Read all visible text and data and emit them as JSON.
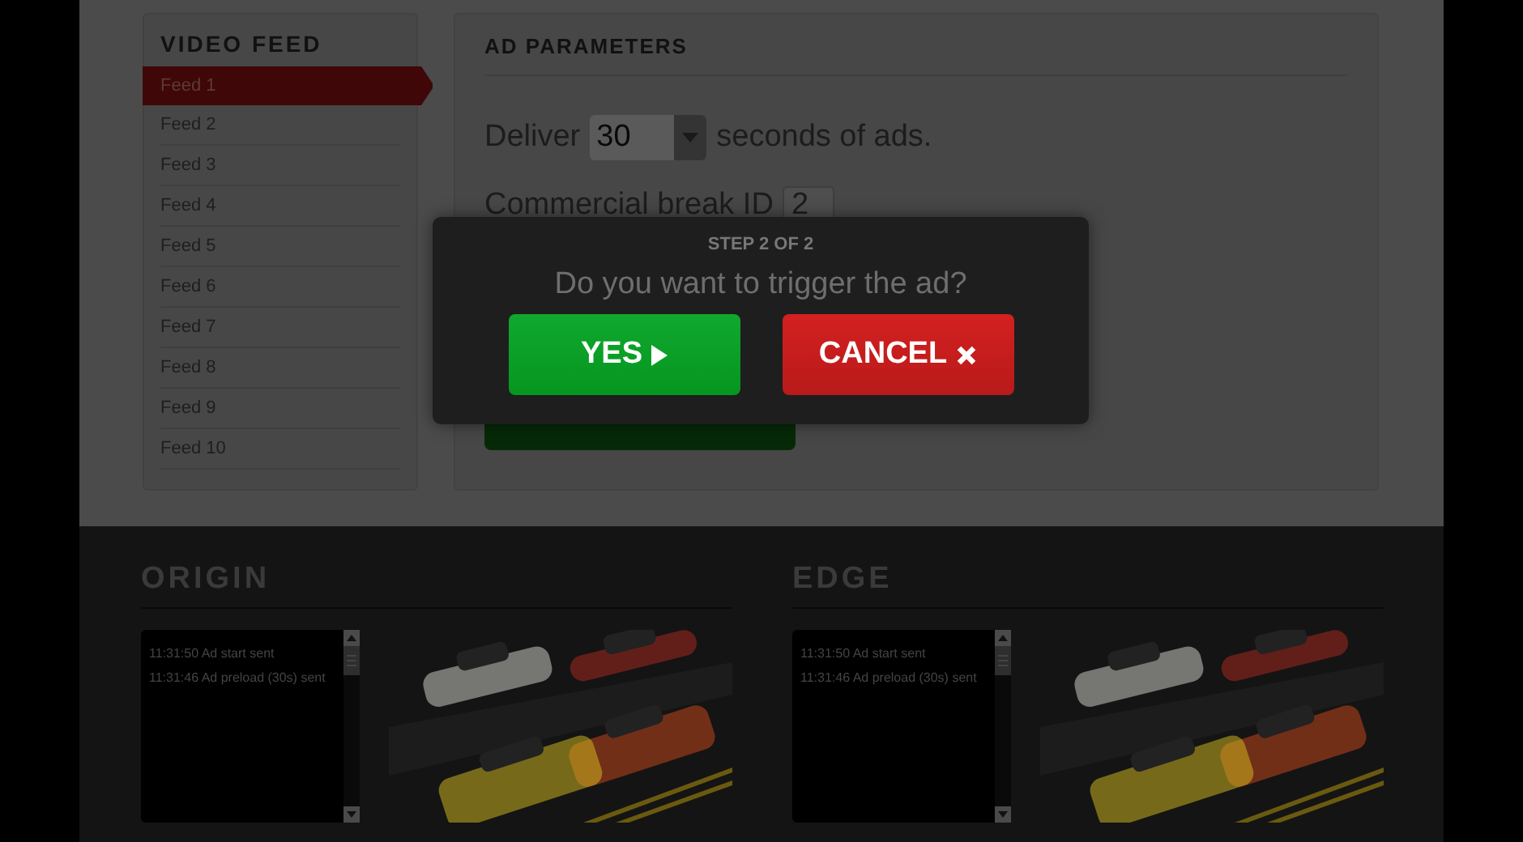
{
  "sidebar": {
    "title": "VIDEO FEED",
    "items": [
      {
        "label": "Feed 1",
        "selected": true
      },
      {
        "label": "Feed 2",
        "selected": false
      },
      {
        "label": "Feed 3",
        "selected": false
      },
      {
        "label": "Feed 4",
        "selected": false
      },
      {
        "label": "Feed 5",
        "selected": false
      },
      {
        "label": "Feed 6",
        "selected": false
      },
      {
        "label": "Feed 7",
        "selected": false
      },
      {
        "label": "Feed 8",
        "selected": false
      },
      {
        "label": "Feed 9",
        "selected": false
      },
      {
        "label": "Feed 10",
        "selected": false
      }
    ]
  },
  "ad_parameters": {
    "title": "AD PARAMETERS",
    "deliver": {
      "before": "Deliver",
      "value": "30",
      "after": "seconds of ads."
    },
    "break_id": {
      "label": "Commercial break ID",
      "value": "2"
    }
  },
  "dialog": {
    "step": "STEP 2 OF 2",
    "question": "Do you want to trigger the ad?",
    "buttons": [
      {
        "label": "YES",
        "kind": "confirm"
      },
      {
        "label": "CANCEL",
        "kind": "cancel"
      }
    ]
  },
  "panels": [
    {
      "title": "ORIGIN",
      "log": [
        "11:31:50 Ad start sent",
        "11:31:46 Ad preload (30s) sent"
      ]
    },
    {
      "title": "EDGE",
      "log": [
        "11:31:50 Ad start sent",
        "11:31:46 Ad preload (30s) sent"
      ]
    }
  ]
}
